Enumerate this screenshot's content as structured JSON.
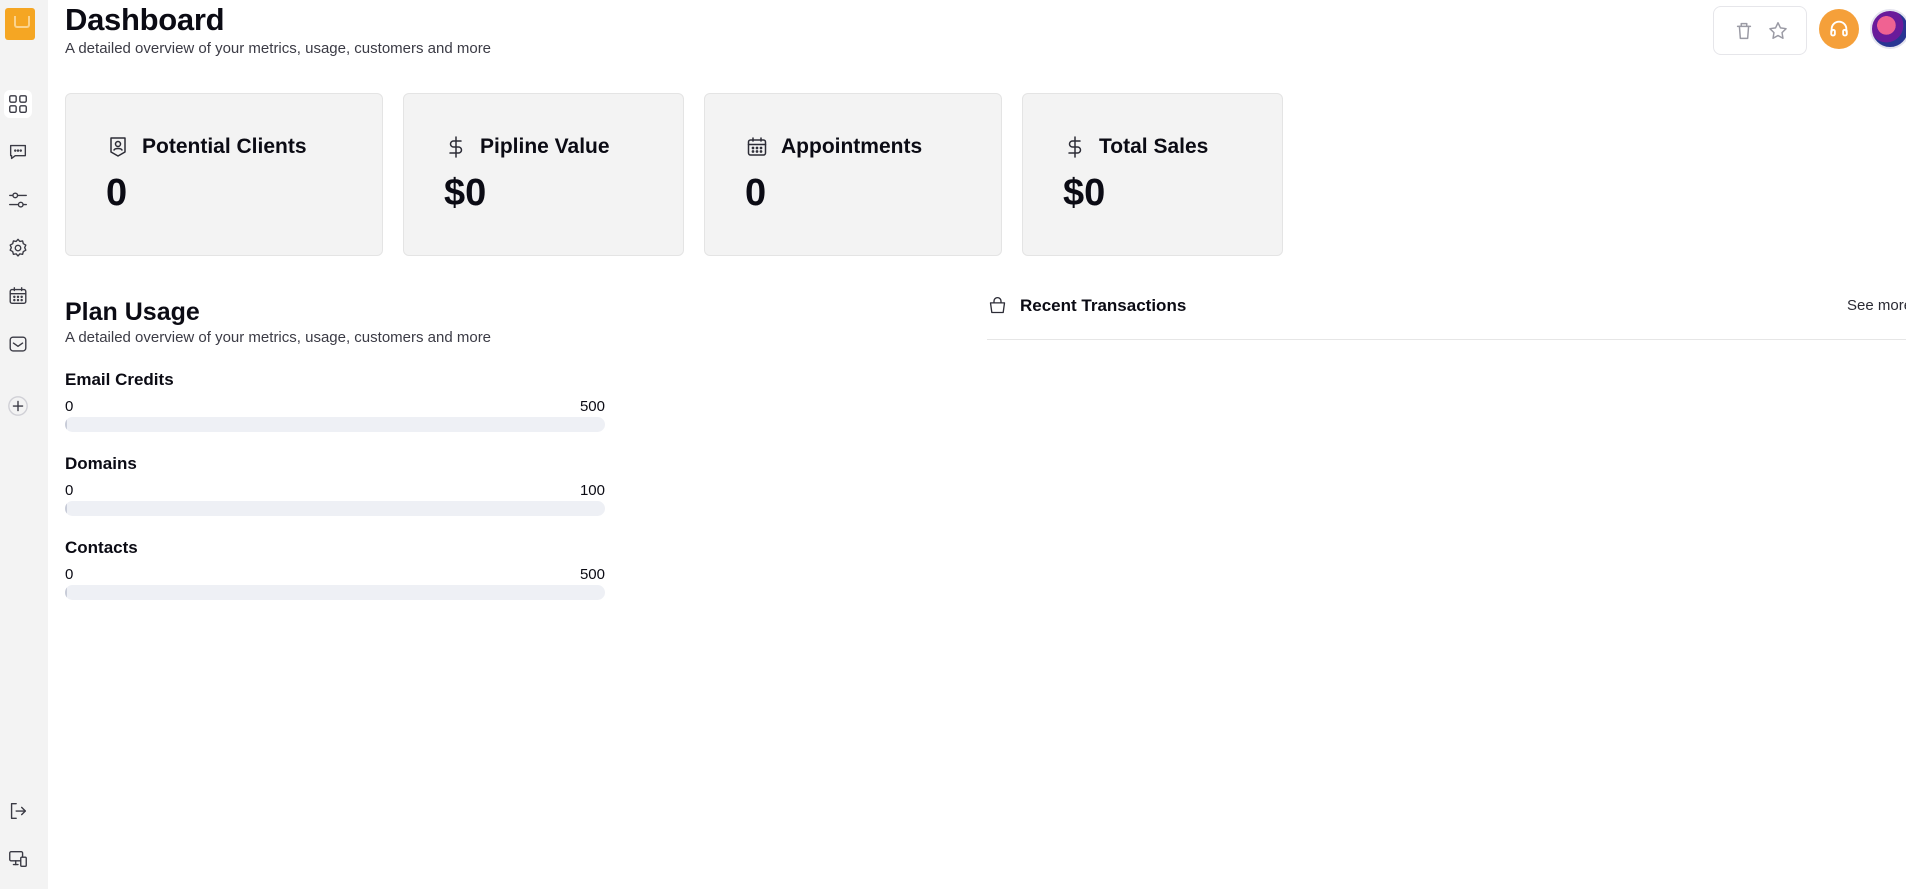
{
  "header": {
    "title": "Dashboard",
    "subtitle": "A detailed overview of your metrics, usage, customers and more"
  },
  "sidebar": {
    "items": [
      {
        "name": "dashboard",
        "icon": "grid-icon",
        "active": true
      },
      {
        "name": "conversations",
        "icon": "chat-icon",
        "active": false
      },
      {
        "name": "pipelines",
        "icon": "sliders-icon",
        "active": false
      },
      {
        "name": "settings",
        "icon": "gear-icon",
        "active": false
      },
      {
        "name": "calendar",
        "icon": "calendar-icon",
        "active": false
      },
      {
        "name": "inbox",
        "icon": "inbox-icon",
        "active": false
      },
      {
        "name": "add",
        "icon": "plus-icon",
        "active": false
      }
    ],
    "bottom": [
      {
        "name": "logout",
        "icon": "logout-icon"
      },
      {
        "name": "devices",
        "icon": "devices-icon"
      }
    ]
  },
  "topbar": {
    "icons": [
      "trash-icon",
      "star-icon",
      "headset-icon",
      "avatar"
    ],
    "support_color": "#f5a03a"
  },
  "stats": [
    {
      "label": "Potential Clients",
      "value": "0",
      "icon": "client-icon"
    },
    {
      "label": "Pipline Value",
      "value": "$0",
      "icon": "dollar-icon"
    },
    {
      "label": "Appointments",
      "value": "0",
      "icon": "calendar-icon"
    },
    {
      "label": "Total Sales",
      "value": "$0",
      "icon": "dollar-icon"
    }
  ],
  "plan_usage": {
    "title": "Plan Usage",
    "subtitle": "A detailed overview of your metrics, usage, customers and more",
    "items": [
      {
        "label": "Email Credits",
        "used": "0",
        "limit": "500",
        "fraction": 0
      },
      {
        "label": "Domains",
        "used": "0",
        "limit": "100",
        "fraction": 0
      },
      {
        "label": "Contacts",
        "used": "0",
        "limit": "500",
        "fraction": 0
      }
    ]
  },
  "transactions": {
    "title": "Recent Transactions",
    "see_more": "See more",
    "icon": "bag-icon"
  },
  "colors": {
    "accent": "#f5a623",
    "sidebar_bg": "#f3f3f3",
    "card_bg": "#f3f3f3"
  }
}
